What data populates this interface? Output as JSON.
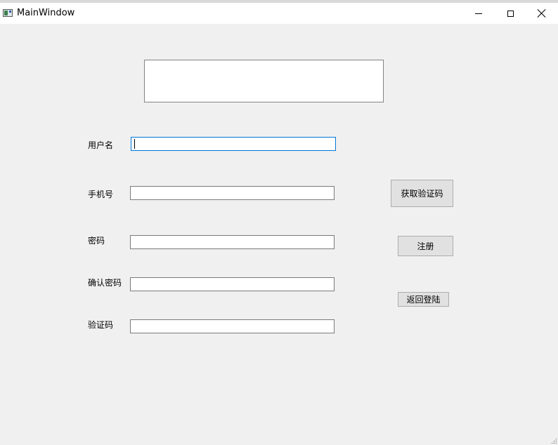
{
  "window": {
    "title": "MainWindow",
    "icon": "app-window-icon"
  },
  "form": {
    "username_label": "用户名",
    "phone_label": "手机号",
    "password_label": "密码",
    "confirm_password_label": "确认密码",
    "verify_code_label": "验证码",
    "username_value": "",
    "phone_value": "",
    "password_value": "",
    "confirm_password_value": "",
    "verify_code_value": ""
  },
  "buttons": {
    "get_code": "获取验证码",
    "register": "注册",
    "back_to_login": "返回登陆"
  },
  "colors": {
    "background": "#f0f0f0",
    "focus_border": "#0078d7",
    "button_face": "#e1e1e1"
  }
}
